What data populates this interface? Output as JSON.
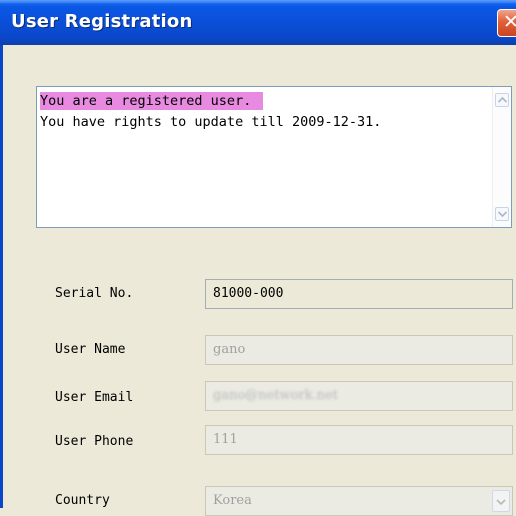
{
  "window": {
    "title": "User Registration",
    "close_icon": "close-icon"
  },
  "message": {
    "line1": "You are a registered user.",
    "line2": "You have rights to update till 2009-12-31.",
    "highlight_color": "#e88ae0"
  },
  "form": {
    "serial": {
      "label": "Serial No.",
      "value": "81000-000"
    },
    "name": {
      "label": "User Name",
      "value": "gano"
    },
    "email": {
      "label": "User Email",
      "value": "gano@network.net"
    },
    "phone": {
      "label": "User Phone",
      "value": "111"
    },
    "country": {
      "label": "Country",
      "value": "Korea"
    }
  },
  "colors": {
    "title_bar": "#0a4fd8",
    "dialog_bg": "#ece9d8",
    "close_button": "#e2603a"
  }
}
